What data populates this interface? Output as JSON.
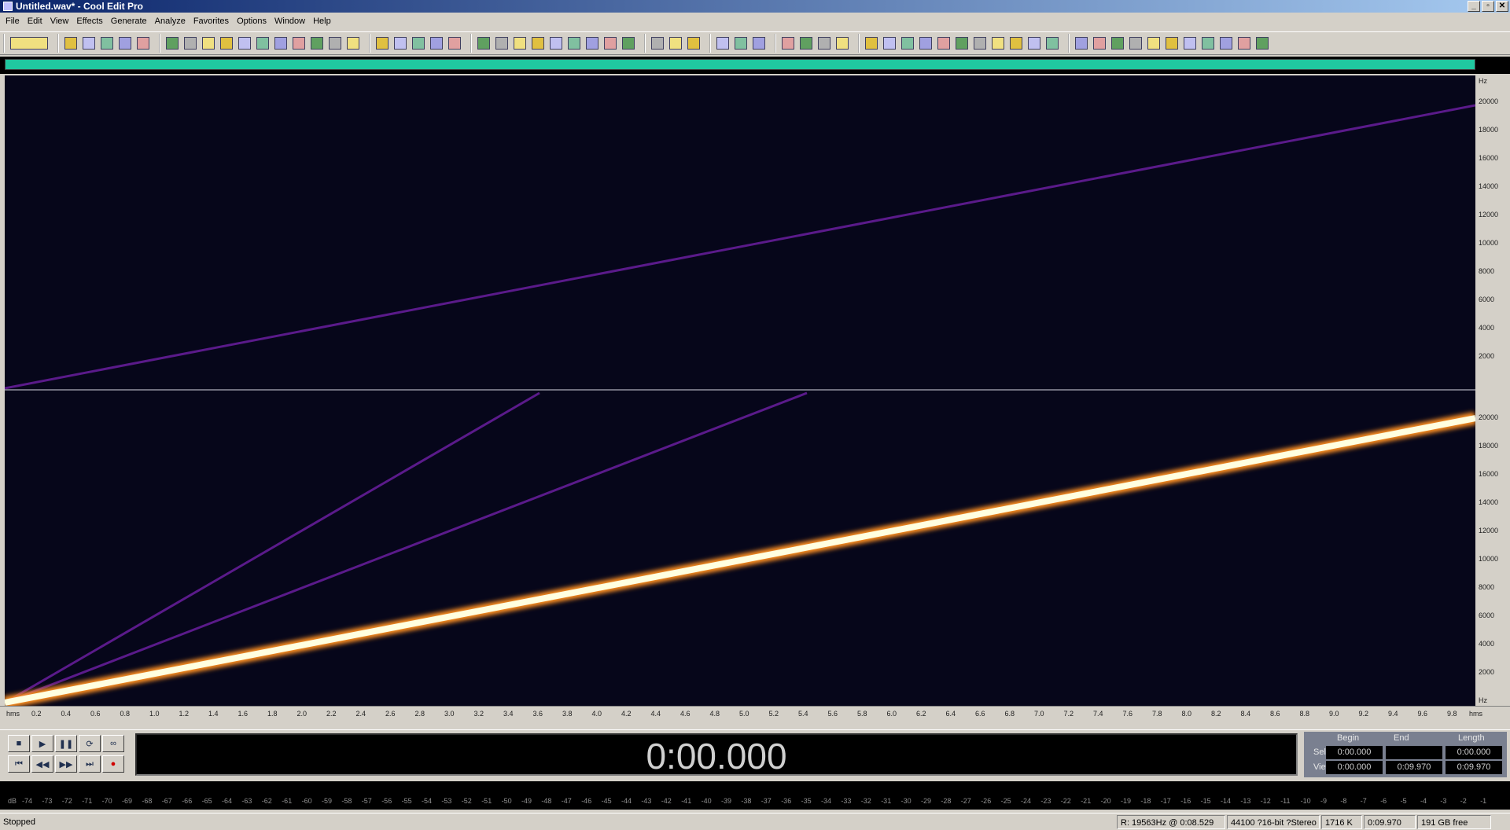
{
  "window": {
    "title": "Untitled.wav* - Cool Edit Pro",
    "minimize": "_",
    "restore": "▫",
    "close": "✕"
  },
  "menu": [
    "File",
    "Edit",
    "View",
    "Effects",
    "Generate",
    "Analyze",
    "Favorites",
    "Options",
    "Window",
    "Help"
  ],
  "toolbar": {
    "groups": [
      {
        "count": 1,
        "wide": true
      },
      {
        "count": 5
      },
      {
        "count": 11
      },
      {
        "count": 5
      },
      {
        "count": 9
      },
      {
        "count": 3
      },
      {
        "count": 3
      },
      {
        "count": 4
      },
      {
        "count": 11
      },
      {
        "count": 11
      }
    ],
    "colors": [
      "#f0e080",
      "#e0c040",
      "#c0c0f0",
      "#80c0a0",
      "#a0a0e0",
      "#e0a0a0",
      "#60a060",
      "#b0b0b0"
    ]
  },
  "spectral": {
    "freq_unit": "Hz",
    "freq_ticks": [
      "20000",
      "18000",
      "16000",
      "14000",
      "12000",
      "10000",
      "8000",
      "6000",
      "4000",
      "2000"
    ],
    "time_unit": "hms",
    "time_ticks": [
      "0.2",
      "0.4",
      "0.6",
      "0.8",
      "1.0",
      "1.2",
      "1.4",
      "1.6",
      "1.8",
      "2.0",
      "2.2",
      "2.4",
      "2.6",
      "2.8",
      "3.0",
      "3.2",
      "3.4",
      "3.6",
      "3.8",
      "4.0",
      "4.2",
      "4.4",
      "4.6",
      "4.8",
      "5.0",
      "5.2",
      "5.4",
      "5.6",
      "5.8",
      "6.0",
      "6.2",
      "6.4",
      "6.6",
      "6.8",
      "7.0",
      "7.2",
      "7.4",
      "7.6",
      "7.8",
      "8.0",
      "8.2",
      "8.4",
      "8.6",
      "8.8",
      "9.0",
      "9.2",
      "9.4",
      "9.6",
      "9.8"
    ],
    "colors": {
      "bg": "#06061a",
      "sweep_core": "#ffffe0",
      "sweep_glow": "#ff9020",
      "harmonic": "#5a1a8a"
    }
  },
  "transport": {
    "buttons": [
      "■",
      "▶",
      "❚❚",
      "⟳",
      "∞",
      "⏮",
      "◀◀",
      "▶▶",
      "⏭",
      "●"
    ],
    "time": "0:00.000"
  },
  "selview": {
    "headers": {
      "begin": "Begin",
      "end": "End",
      "length": "Length"
    },
    "sel_label": "Sel",
    "view_label": "View",
    "sel": {
      "begin": "0:00.000",
      "end": "",
      "length": "0:00.000"
    },
    "view": {
      "begin": "0:00.000",
      "end": "0:09.970",
      "length": "0:09.970"
    }
  },
  "level_meter": {
    "unit": "dB",
    "ticks": [
      "-74",
      "-73",
      "-72",
      "-71",
      "-70",
      "-69",
      "-68",
      "-67",
      "-66",
      "-65",
      "-64",
      "-63",
      "-62",
      "-61",
      "-60",
      "-59",
      "-58",
      "-57",
      "-56",
      "-55",
      "-54",
      "-53",
      "-52",
      "-51",
      "-50",
      "-49",
      "-48",
      "-47",
      "-46",
      "-45",
      "-44",
      "-43",
      "-42",
      "-41",
      "-40",
      "-39",
      "-38",
      "-37",
      "-36",
      "-35",
      "-34",
      "-33",
      "-32",
      "-31",
      "-30",
      "-29",
      "-28",
      "-27",
      "-26",
      "-25",
      "-24",
      "-23",
      "-22",
      "-21",
      "-20",
      "-19",
      "-18",
      "-17",
      "-16",
      "-15",
      "-14",
      "-13",
      "-12",
      "-11",
      "-10",
      "-9",
      "-8",
      "-7",
      "-6",
      "-5",
      "-4",
      "-3",
      "-2",
      "-1"
    ]
  },
  "status": {
    "state": "Stopped",
    "cursor": "R: 19563Hz @  0:08.529",
    "format": "44100 ?16-bit ?Stereo",
    "size": "1716 K",
    "duration": "0:09.970",
    "free": "191 GB free"
  }
}
